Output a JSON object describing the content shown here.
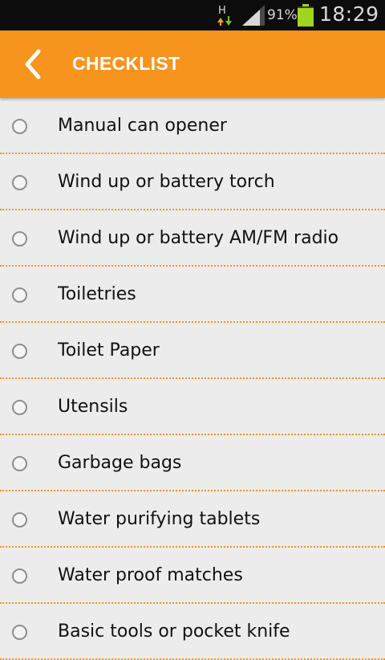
{
  "status_bar": {
    "network_type": "H",
    "battery_percent": "91%",
    "battery_level": 0.91,
    "time": "18:29"
  },
  "app_bar": {
    "title": "CHECKLIST",
    "back_icon": "chevron-left-icon"
  },
  "colors": {
    "accent": "#f7941d",
    "background": "#ececec",
    "status_bar": "#0c0c0c",
    "battery": "#9fd51c"
  },
  "checklist": {
    "items": [
      {
        "label": "Manual can opener",
        "checked": false
      },
      {
        "label": "Wind up or battery torch",
        "checked": false
      },
      {
        "label": "Wind up or battery AM/FM radio",
        "checked": false
      },
      {
        "label": "Toiletries",
        "checked": false
      },
      {
        "label": "Toilet Paper",
        "checked": false
      },
      {
        "label": "Utensils",
        "checked": false
      },
      {
        "label": "Garbage bags",
        "checked": false
      },
      {
        "label": "Water purifying tablets",
        "checked": false
      },
      {
        "label": "Water proof matches",
        "checked": false
      },
      {
        "label": "Basic tools or pocket knife",
        "checked": false
      }
    ]
  }
}
